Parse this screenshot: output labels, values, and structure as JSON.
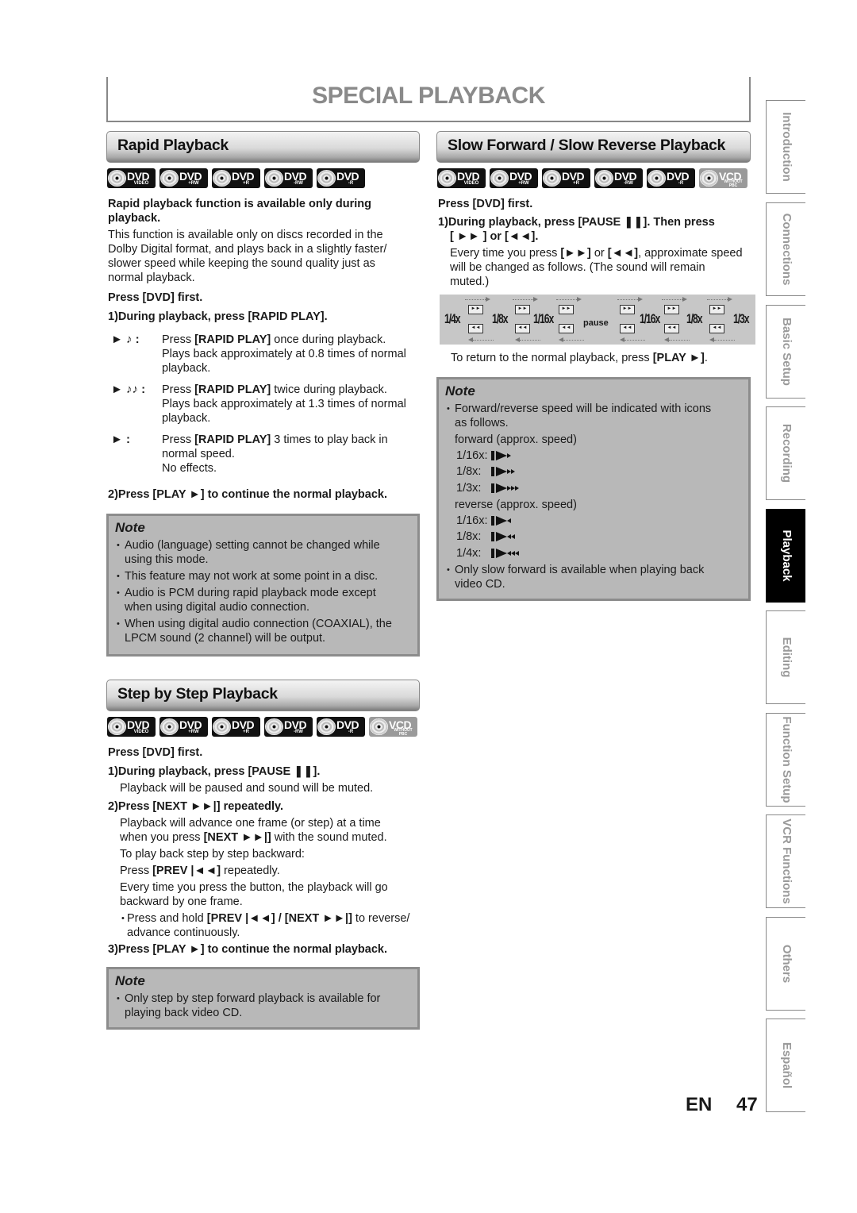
{
  "page": {
    "title": "SPECIAL PLAYBACK",
    "lang_code": "EN",
    "page_number": "47"
  },
  "side_tabs": [
    {
      "label": "Introduction",
      "active": false
    },
    {
      "label": "Connections",
      "active": false
    },
    {
      "label": "Basic Setup",
      "active": false
    },
    {
      "label": "Recording",
      "active": false
    },
    {
      "label": "Playback",
      "active": true
    },
    {
      "label": "Editing",
      "active": false
    },
    {
      "label": "Function Setup",
      "active": false
    },
    {
      "label": "VCR Functions",
      "active": false
    },
    {
      "label": "Others",
      "active": false
    },
    {
      "label": "Español",
      "active": false
    }
  ],
  "disc_icons": {
    "dvd_video": {
      "label": "DVD",
      "sub": "VIDEO"
    },
    "dvd_plus_rw": {
      "label": "DVD",
      "sub": "+RW"
    },
    "dvd_plus_r": {
      "label": "DVD",
      "sub": "+R"
    },
    "dvd_minus_rw": {
      "label": "DVD",
      "sub": "-RW"
    },
    "dvd_minus_r": {
      "label": "DVD",
      "sub": "-R"
    },
    "vcd": {
      "label": "VCD",
      "sub": "WITHOUT PBC"
    }
  },
  "rapid": {
    "heading": "Rapid Playback",
    "intro_bold_1": "Rapid playback function is available only during",
    "intro_bold_2": "playback.",
    "intro_lines": [
      "This function is available only on discs recorded in the",
      "Dolby Digital format, and plays back in a slightly faster/",
      "slower speed while keeping the sound quality just as",
      "normal playback."
    ],
    "press_first": "Press [DVD] first.",
    "step1": "1)During playback, press [RAPID PLAY].",
    "modes": [
      {
        "symbol": "► ♪ :",
        "press": "Press ",
        "key": "[RAPID PLAY]",
        "rest": " once during playback.",
        "lines": [
          "Plays back approximately at 0.8 times of normal",
          "playback."
        ]
      },
      {
        "symbol": "► ♪♪ :",
        "press": "Press ",
        "key": "[RAPID PLAY]",
        "rest": " twice during playback.",
        "lines": [
          "Plays back approximately at 1.3 times of normal",
          "playback."
        ]
      },
      {
        "symbol": "► :",
        "press": "Press ",
        "key": "[RAPID PLAY]",
        "rest": " 3 times to play back in",
        "lines": [
          "normal speed.",
          "No effects."
        ]
      }
    ],
    "step2": "2)Press [PLAY ►] to continue the normal playback.",
    "note": {
      "title": "Note",
      "items": [
        [
          "Audio (language) setting cannot be changed while",
          "using this mode."
        ],
        [
          "This feature may not work at some point in a disc."
        ],
        [
          "Audio is PCM during rapid playback mode except",
          "when using digital audio connection."
        ],
        [
          "When using digital audio connection (COAXIAL), the",
          "LPCM sound (2 channel) will be output."
        ]
      ]
    }
  },
  "step": {
    "heading": "Step by Step Playback",
    "press_first": "Press [DVD] first.",
    "step1": "1)During playback, press [PAUSE ❚❚].",
    "step1_desc": "Playback will be paused and sound will be muted.",
    "step2": "2)Press [NEXT ►►|] repeatedly.",
    "step2_line1": "Playback will advance one frame (or step) at a time",
    "step2_line2_a": "when you press ",
    "step2_line2_key": "[NEXT ►►|]",
    "step2_line2_b": " with the sound muted.",
    "backward_intro": "To play back step by step backward:",
    "backward_a": "Press ",
    "backward_key": "[PREV |◄◄]",
    "backward_b": " repeatedly.",
    "every_time_1": "Every time you press the button, the playback will go",
    "every_time_2": "backward by one frame.",
    "hold_a": "Press and hold ",
    "hold_key": "[PREV |◄◄] / [NEXT ►►|]",
    "hold_b": " to reverse/",
    "hold_2": "advance continuously.",
    "step3": "3)Press [PLAY ►] to continue the normal playback.",
    "note": {
      "title": "Note",
      "items": [
        [
          "Only step by step forward playback is available for",
          "playing back video CD."
        ]
      ]
    }
  },
  "slow": {
    "heading": "Slow Forward / Slow Reverse Playback",
    "press_first": "Press [DVD] first.",
    "step1_a": "1)During playback, press [PAUSE ❚❚]. Then press",
    "step1_b": "[ ►► ] or [◄◄].",
    "desc_a": "Every time you press ",
    "desc_k1": "[►►]",
    "desc_or": " or ",
    "desc_k2": "[◄◄]",
    "desc_b": ", approximate speed",
    "desc_2": "will be changed as follows. (The sound will remain",
    "desc_3": "muted.)",
    "diagram": {
      "speeds": [
        "1/4x",
        "1/8x",
        "1/16x",
        "pause",
        "1/16x",
        "1/8x",
        "1/3x"
      ],
      "fwd_btn": "►►",
      "rev_btn": "◄◄"
    },
    "return_a": "To return to the normal playback, press ",
    "return_key": "[PLAY ►]",
    "return_b": ".",
    "note": {
      "title": "Note",
      "item1": [
        "Forward/reverse speed will be indicated with icons",
        "as follows."
      ],
      "forward_label": "forward (approx. speed)",
      "forward": [
        {
          "speed": "1/16x:",
          "arrows": 1
        },
        {
          "speed": "1/8x:",
          "arrows": 2
        },
        {
          "speed": "1/3x:",
          "arrows": 3
        }
      ],
      "reverse_label": "reverse (approx. speed)",
      "reverse": [
        {
          "speed": "1/16x:",
          "arrows": 1
        },
        {
          "speed": "1/8x:",
          "arrows": 2
        },
        {
          "speed": "1/4x:",
          "arrows": 3
        }
      ],
      "item2": [
        "Only slow forward is available when playing back",
        "video CD."
      ]
    }
  }
}
